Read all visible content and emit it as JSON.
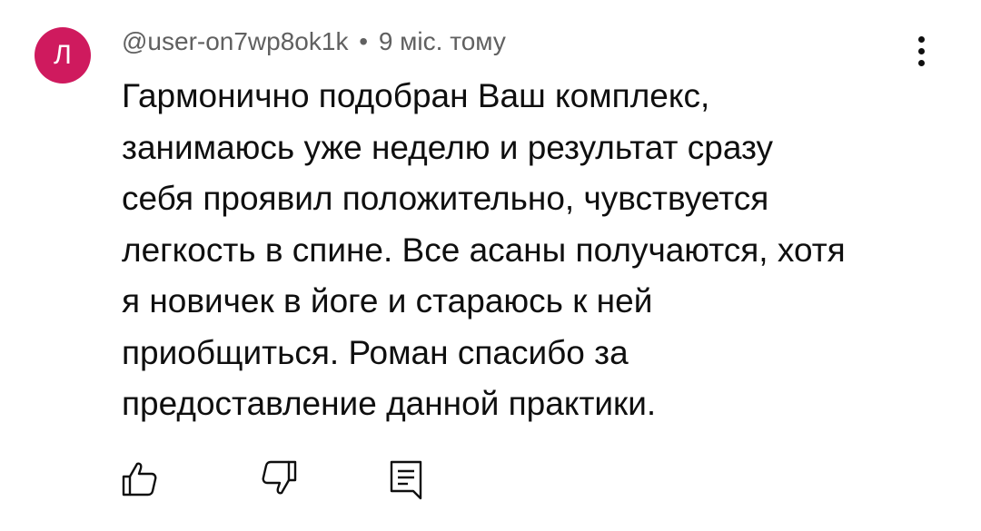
{
  "comment": {
    "avatar_letter": "Л",
    "avatar_color": "#cf1a5e",
    "author": "@user-on7wp8ok1k",
    "separator": "•",
    "time": "9 міс. тому",
    "text": "Гармонично подобран Ваш комплекс,\nзанимаюсь уже неделю и результат  сразу\nсебя проявил положительно, чувствуется\nлегкость в спине. Все асаны получаются, хотя\nя новичек в йоге и стараюсь к ней\nприобщиться. Роман спасибо за\nпредоставление данной практики."
  },
  "actions": {
    "like_icon": "thumb-up-icon",
    "dislike_icon": "thumb-down-icon",
    "reply_icon": "comment-icon",
    "menu_icon": "more-vert-icon"
  }
}
